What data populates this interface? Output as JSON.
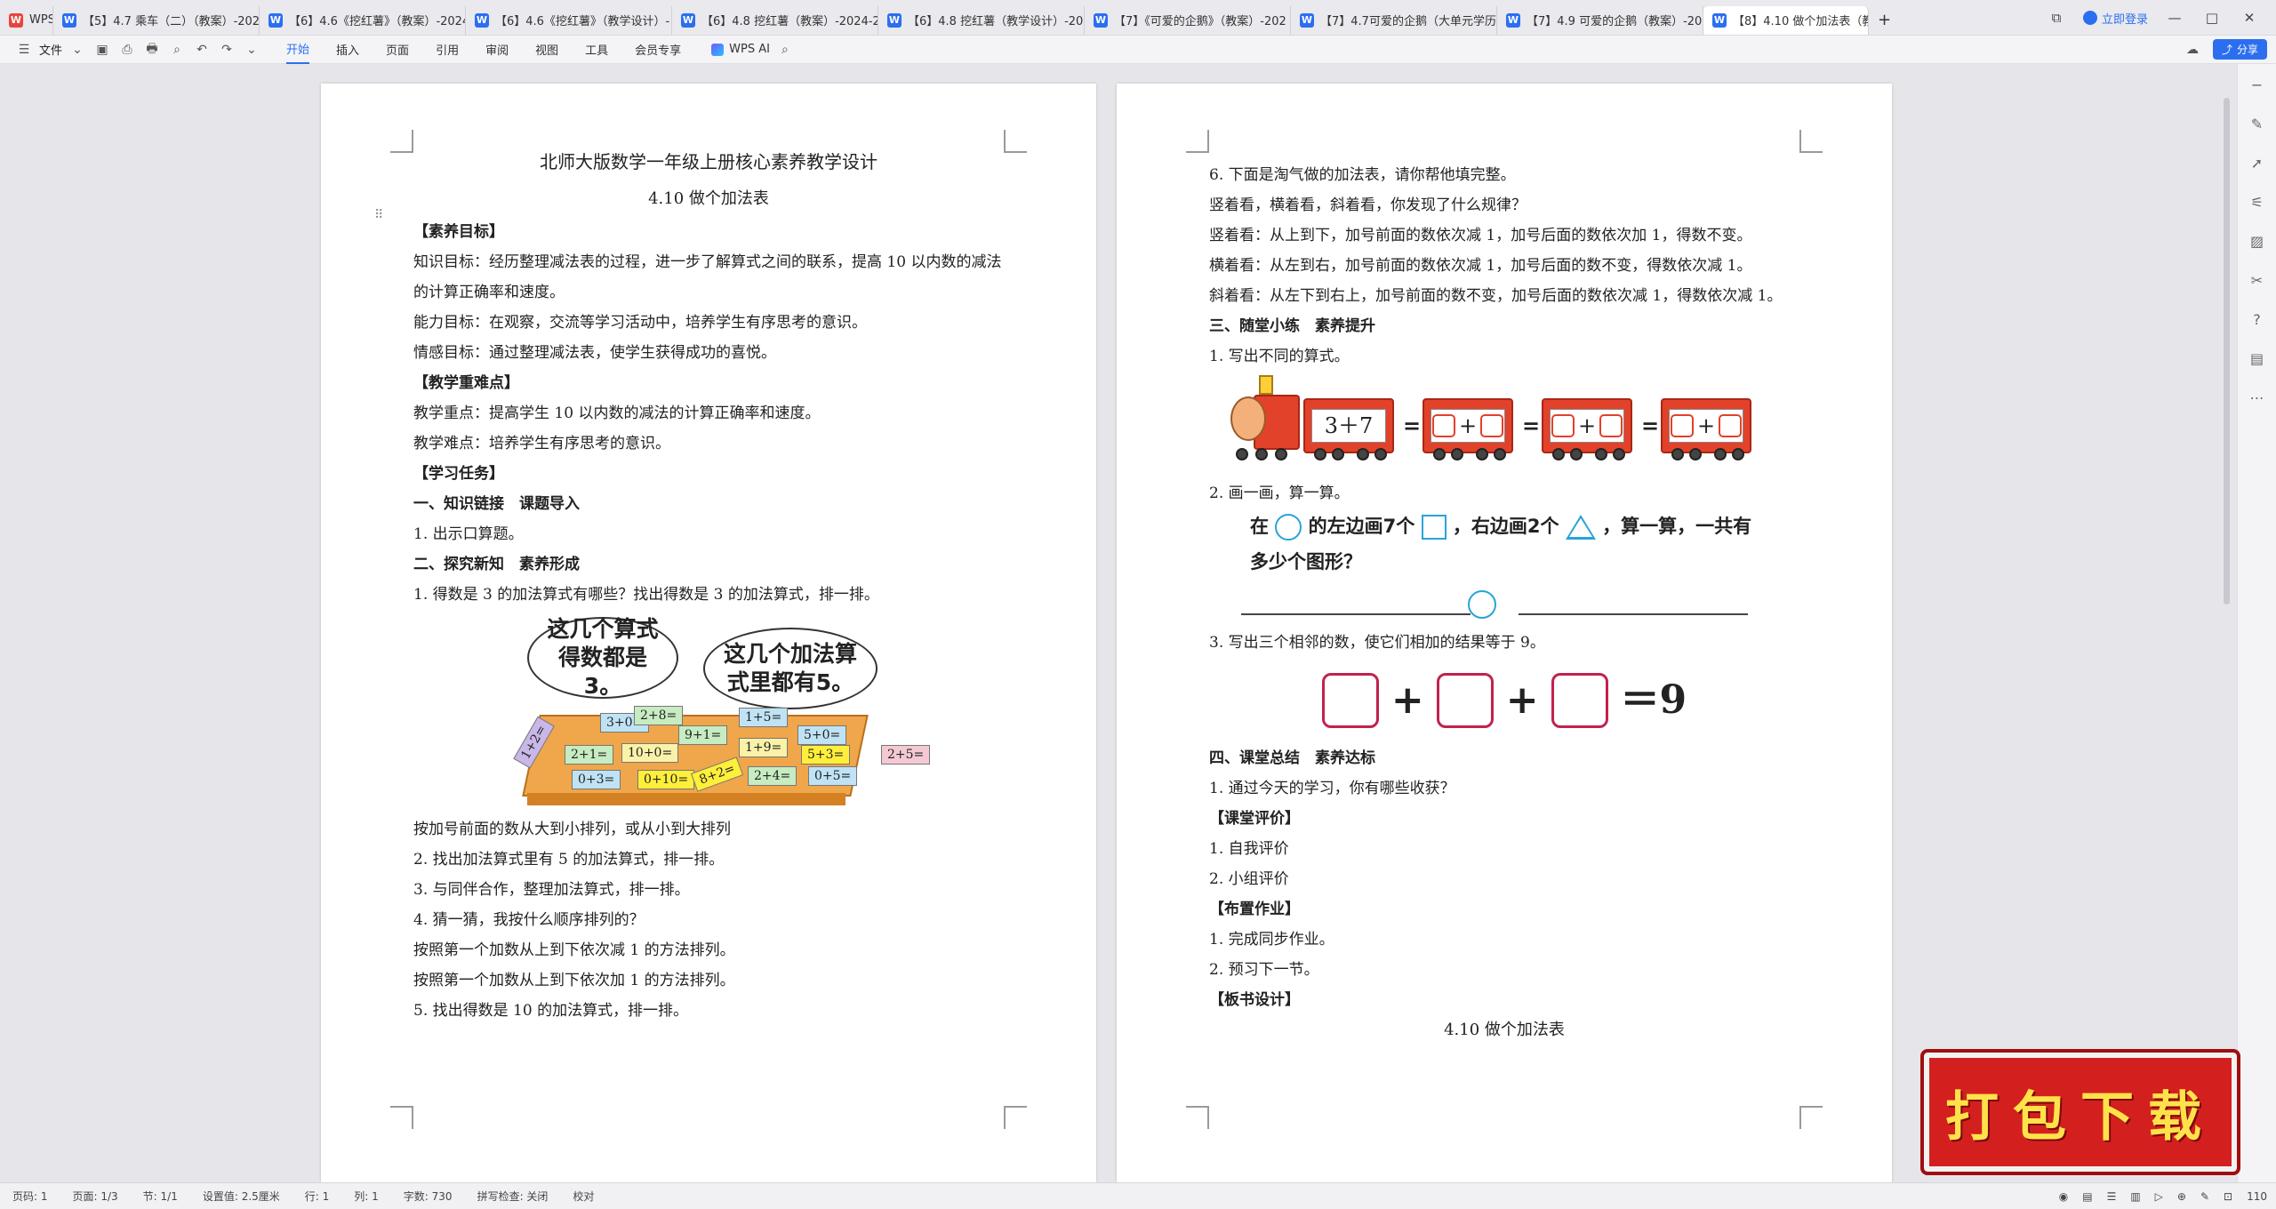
{
  "tabs": [
    {
      "label": "WPS",
      "type": "app"
    },
    {
      "label": "【5】4.7 乘车（二）（教案）-2024-"
    },
    {
      "label": "【6】4.6《挖红薯》（教案）-2024-"
    },
    {
      "label": "【6】4.6《挖红薯》（教学设计）-"
    },
    {
      "label": "【6】4.8 挖红薯（教案）-2024-20"
    },
    {
      "label": "【6】4.8 挖红薯（教学设计）-2024-2"
    },
    {
      "label": "【7】《可爱的企鹅》（教案）-202"
    },
    {
      "label": "【7】4.7可爱的企鹅（大单元学历案"
    },
    {
      "label": "【7】4.9 可爱的企鹅（教案）-2024"
    },
    {
      "label": "【8】4.10 做个加法表（教",
      "active": true
    }
  ],
  "header": {
    "login_label": "立即登录",
    "share_label": "分享"
  },
  "ribbon": {
    "file_label": "文件",
    "menu": [
      "开始",
      "插入",
      "页面",
      "引用",
      "审阅",
      "视图",
      "工具",
      "会员专享"
    ],
    "active_menu": "开始",
    "ai_label": "WPS AI"
  },
  "page1": {
    "title": "北师大版数学一年级上册核心素养教学设计",
    "subtitle": "4.10 做个加法表",
    "lines": [
      {
        "text": "【素养目标】",
        "bold": true
      },
      {
        "text": "知识目标：经历整理减法表的过程，进一步了解算式之间的联系，提高 10 以内数的减法的计算正确率和速度。",
        "wrap": true
      },
      {
        "text": "能力目标：在观察，交流等学习活动中，培养学生有序思考的意识。"
      },
      {
        "text": "情感目标：通过整理减法表，使学生获得成功的喜悦。"
      },
      {
        "text": "【教学重难点】",
        "bold": true
      },
      {
        "text": "教学重点：提高学生 10 以内数的减法的计算正确率和速度。"
      },
      {
        "text": "教学难点：培养学生有序思考的意识。"
      },
      {
        "text": "【学习任务】",
        "bold": true
      },
      {
        "text": "一、知识链接　课题导入",
        "bold": true
      },
      {
        "text": "1. 出示口算题。"
      },
      {
        "text": "二、探究新知　素养形成",
        "bold": true
      },
      {
        "text": "1. 得数是 3 的加法算式有哪些？找出得数是 3 的加法算式，排一排。"
      }
    ],
    "illustration": {
      "bubble1": "这几个算式得数都是3。",
      "bubble2": "这几个加法算式里都有5。",
      "cards": [
        "1+2=",
        "3+0=",
        "2+8=",
        "1+5=",
        "2+1=",
        "10+0=",
        "9+1=",
        "1+9=",
        "5+0=",
        "5+3=",
        "0+3=",
        "0+10=",
        "8+2=",
        "2+4=",
        "0+5=",
        "2+5="
      ]
    },
    "lines_after": [
      {
        "text": "按加号前面的数从大到小排列，或从小到大排列"
      },
      {
        "text": "2. 找出加法算式里有 5 的加法算式，排一排。"
      },
      {
        "text": "3. 与同伴合作，整理加法算式，排一排。"
      },
      {
        "text": "4. 猜一猜，我按什么顺序排列的？"
      },
      {
        "text": "按照第一个加数从上到下依次减 1 的方法排列。"
      },
      {
        "text": "按照第一个加数从上到下依次加 1 的方法排列。"
      },
      {
        "text": "5. 找出得数是 10 的加法算式，排一排。"
      }
    ]
  },
  "page2": {
    "lines_top": [
      {
        "text": "6. 下面是淘气做的加法表，请你帮他填完整。"
      },
      {
        "text": "竖着看，横着看，斜着看，你发现了什么规律？"
      },
      {
        "text": "竖着看：从上到下，加号前面的数依次减 1，加号后面的数依次加 1，得数不变。"
      },
      {
        "text": "横着看：从左到右，加号前面的数依次减 1，加号后面的数不变，得数依次减 1。"
      },
      {
        "text": "斜着看：从左下到右上，加号前面的数不变，加号后面的数依次减 1，得数依次减 1。"
      },
      {
        "text": "三、随堂小练　素养提升",
        "bold": true
      },
      {
        "text": "1. 写出不同的算式。"
      }
    ],
    "train": {
      "first_car": "3＋7",
      "plus": "+",
      "equals": "="
    },
    "q2_label": "2. 画一画，算一算。",
    "shape_question": {
      "part1": "在",
      "part2": "的左边画7个",
      "part3": "，右边画2个",
      "part4": "，算一算，一共有",
      "part5": "多少个图形？"
    },
    "q3_label": "3. 写出三个相邻的数，使它们相加的结果等于 9。",
    "sum": {
      "plus": "+",
      "result": "＝9"
    },
    "lines_bottom": [
      {
        "text": "四、课堂总结　素养达标",
        "bold": true
      },
      {
        "text": "1. 通过今天的学习，你有哪些收获？"
      },
      {
        "text": "【课堂评价】",
        "bold": true
      },
      {
        "text": "1. 自我评价"
      },
      {
        "text": "2. 小组评价"
      },
      {
        "text": "【布置作业】",
        "bold": true
      },
      {
        "text": "1. 完成同步作业。"
      },
      {
        "text": "2. 预习下一节。"
      },
      {
        "text": "【板书设计】",
        "bold": true
      }
    ],
    "board_title": "4.10 做个加法表"
  },
  "status": {
    "page_num": "页码: 1",
    "page_count": "页面: 1/3",
    "section": "节: 1/1",
    "setting": "设置值: 2.5厘米",
    "row": "行: 1",
    "col": "列: 1",
    "word_count": "字数: 730",
    "spellcheck": "拼写检查: 关闭",
    "proof": "校对",
    "zoom": "110"
  },
  "banner": {
    "text": "打包下载"
  }
}
